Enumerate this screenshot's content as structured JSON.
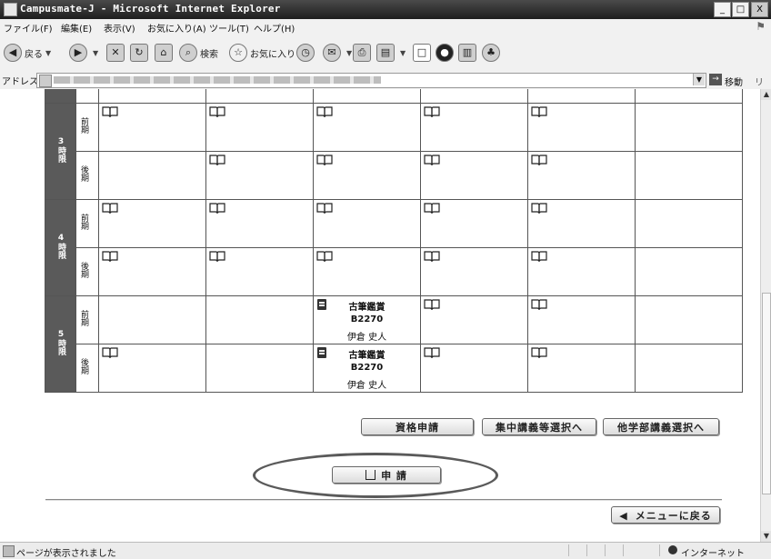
{
  "window": {
    "title": "Campusmate-J - Microsoft Internet Explorer",
    "controls": [
      "_",
      "□",
      "X"
    ]
  },
  "menubar": {
    "items": [
      "ファイル(F)",
      "編集(E)",
      "表示(V)",
      "お気に入り(A)",
      "ツール(T)",
      "ヘルプ(H)"
    ]
  },
  "toolbar": {
    "back_label": "戻る",
    "search_label": "検索",
    "favorites_label": "お気に入り"
  },
  "addressbar": {
    "label": "アドレス(D)",
    "go_label": "移動",
    "links_label": "リンク"
  },
  "timetable": {
    "rows": [
      {
        "period_label": "3時限",
        "terms": [
          {
            "term": "前期",
            "cells": [
              {
                "type": "book"
              },
              {
                "type": "book"
              },
              {
                "type": "book"
              },
              {
                "type": "book"
              },
              {
                "type": "book"
              },
              {
                "type": "empty"
              }
            ]
          },
          {
            "term": "後期",
            "cells": [
              {
                "type": "empty"
              },
              {
                "type": "book"
              },
              {
                "type": "book"
              },
              {
                "type": "book"
              },
              {
                "type": "book"
              },
              {
                "type": "empty"
              }
            ]
          }
        ]
      },
      {
        "period_label": "4時限",
        "terms": [
          {
            "term": "前期",
            "cells": [
              {
                "type": "book"
              },
              {
                "type": "book"
              },
              {
                "type": "book"
              },
              {
                "type": "book"
              },
              {
                "type": "book"
              },
              {
                "type": "empty"
              }
            ]
          },
          {
            "term": "後期",
            "cells": [
              {
                "type": "book"
              },
              {
                "type": "book"
              },
              {
                "type": "book"
              },
              {
                "type": "book"
              },
              {
                "type": "book"
              },
              {
                "type": "empty"
              }
            ]
          }
        ]
      },
      {
        "period_label": "5時限",
        "terms": [
          {
            "term": "前期",
            "cells": [
              {
                "type": "empty"
              },
              {
                "type": "empty"
              },
              {
                "type": "course",
                "name": "古筆鑑賞",
                "code": "B2270",
                "teacher": "伊倉 史人"
              },
              {
                "type": "book"
              },
              {
                "type": "book"
              },
              {
                "type": "empty"
              }
            ]
          },
          {
            "term": "後期",
            "cells": [
              {
                "type": "book"
              },
              {
                "type": "empty"
              },
              {
                "type": "course",
                "name": "古筆鑑賞",
                "code": "B2270",
                "teacher": "伊倉 史人"
              },
              {
                "type": "book"
              },
              {
                "type": "book"
              },
              {
                "type": "empty"
              }
            ]
          }
        ]
      }
    ]
  },
  "actions": {
    "qualification_label": "資格申請",
    "intensive_label": "集中講義等選択へ",
    "other_faculty_label": "他学部講義選択へ",
    "apply_label": "申 請",
    "back_menu_label": "メニューに戻る"
  },
  "statusbar": {
    "status": "ページが表示されました",
    "zone": "インターネット"
  }
}
